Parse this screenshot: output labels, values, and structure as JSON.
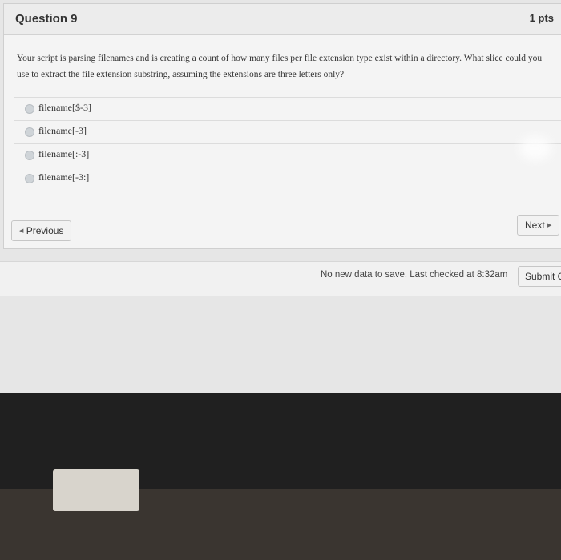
{
  "question": {
    "title": "Question 9",
    "points": "1 pts",
    "text": "Your script is parsing filenames and is creating a count of how many files per file extension type exist within a directory. What slice could you use to extract the file extension substring, assuming the extensions are three letters only?",
    "answers": [
      {
        "label": "filename[$-3]"
      },
      {
        "label": "filename[-3]"
      },
      {
        "label": "filename[:-3]"
      },
      {
        "label": "filename[-3:]"
      }
    ]
  },
  "nav": {
    "previous_label": "Previous",
    "next_label": "Next"
  },
  "status": {
    "text": "No new data to save. Last checked at 8:32am",
    "submit_label": "Submit Q"
  }
}
